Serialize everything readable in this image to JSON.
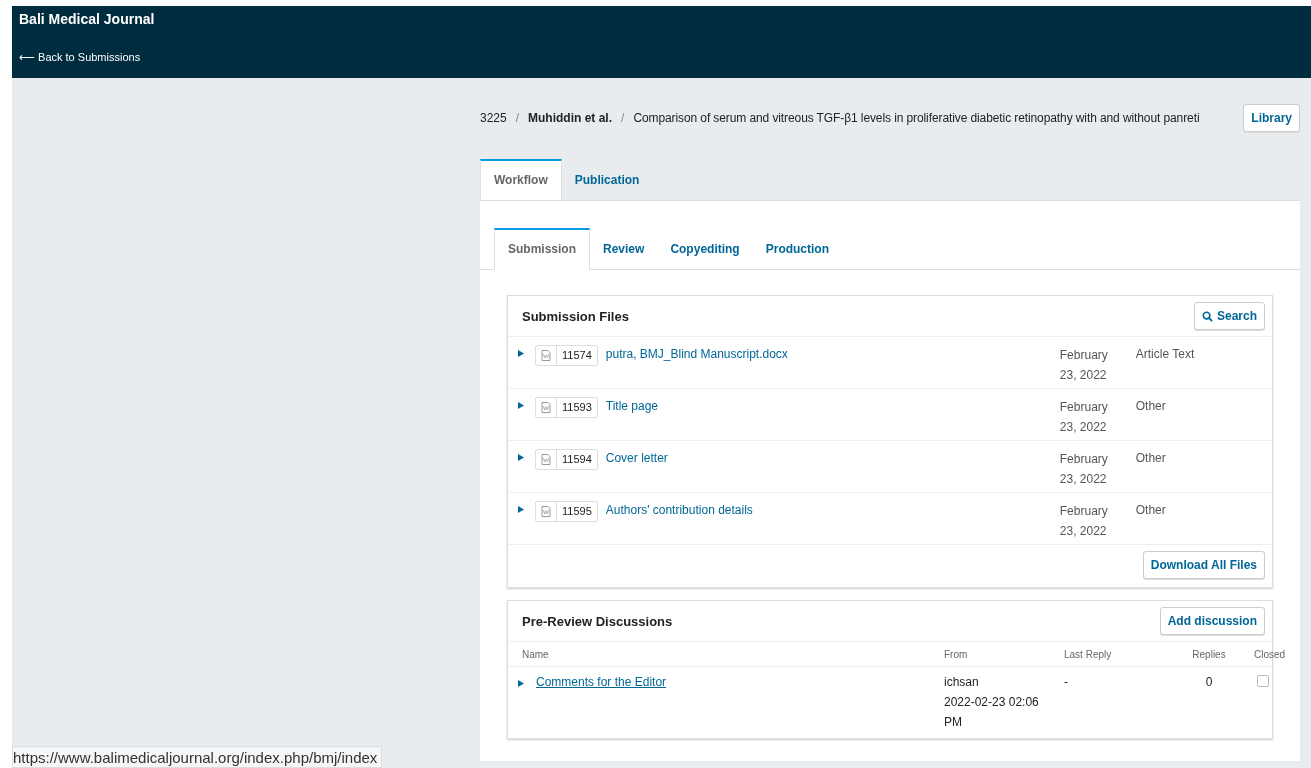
{
  "header": {
    "title": "Bali Medical Journal",
    "back_link": "⟵ Back to Submissions"
  },
  "breadcrumb": {
    "id": "3225",
    "author": "Muhiddin et al.",
    "title": "Comparison of serum and vitreous TGF-β1 levels in proliferative diabetic retinopathy with and without panreti",
    "separator": "/",
    "library_button": "Library"
  },
  "tabs": [
    {
      "label": "Workflow",
      "selected": true
    },
    {
      "label": "Publication",
      "selected": false
    }
  ],
  "subtabs": [
    {
      "label": "Submission",
      "selected": true
    },
    {
      "label": "Review",
      "selected": false
    },
    {
      "label": "Copyediting",
      "selected": false
    },
    {
      "label": "Production",
      "selected": false
    }
  ],
  "submission_files": {
    "title": "Submission Files",
    "search_button": "Search",
    "download_button": "Download All Files",
    "rows": [
      {
        "id": "11574",
        "name": "putra, BMJ_Blind Manuscript.docx",
        "date": "February 23, 2022",
        "type": "Article Text"
      },
      {
        "id": "11593",
        "name": "Title page",
        "date": "February 23, 2022",
        "type": "Other"
      },
      {
        "id": "11594",
        "name": "Cover letter",
        "date": "February 23, 2022",
        "type": "Other"
      },
      {
        "id": "11595",
        "name": "Authors' contribution details",
        "date": "February 23, 2022",
        "type": "Other"
      }
    ]
  },
  "discussions": {
    "title": "Pre-Review Discussions",
    "add_button": "Add discussion",
    "columns": [
      "Name",
      "From",
      "Last Reply",
      "Replies",
      "Closed"
    ],
    "rows": [
      {
        "name": "Comments for the Editor",
        "from": "ichsan",
        "from_date": "2022-02-23 02:06 PM",
        "last_reply": "-",
        "replies": "0",
        "closed": false
      }
    ]
  },
  "status_bar": {
    "url": "https://www.balimedicaljournal.org/index.php/bmj/index"
  }
}
